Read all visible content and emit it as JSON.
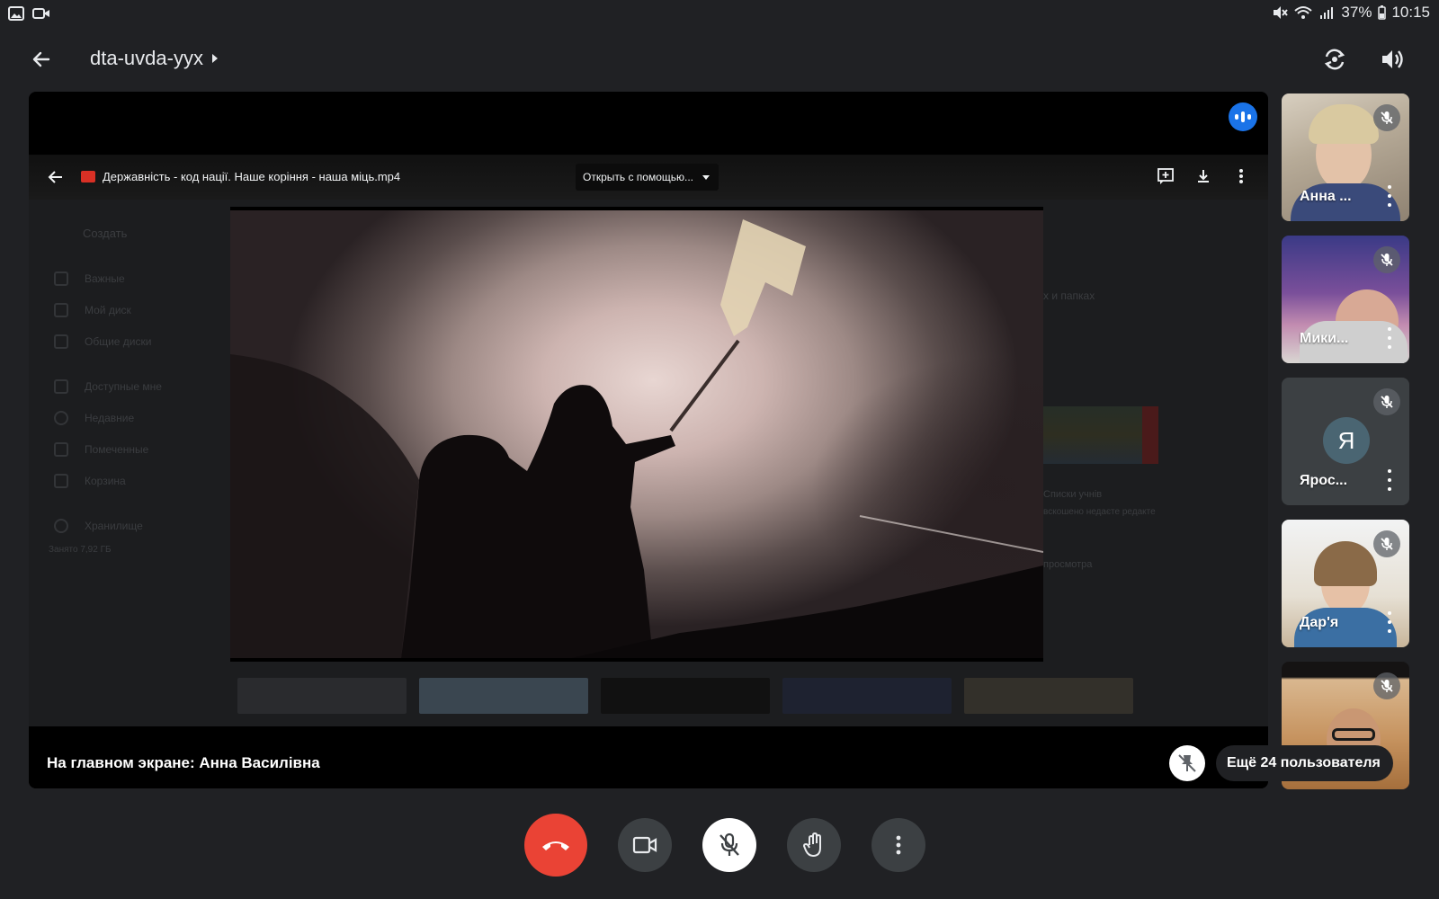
{
  "status_bar": {
    "battery": "37%",
    "time": "10:15",
    "icons": [
      "gallery-icon",
      "video-recorder-icon",
      "mute-icon",
      "wifi-icon",
      "signal-icon",
      "battery-icon"
    ]
  },
  "header": {
    "meeting_code": "dta-uvda-yyx",
    "icons": [
      "back-arrow-icon",
      "chevron-right-icon",
      "switch-camera-icon",
      "speaker-icon"
    ]
  },
  "shared_screen": {
    "file_name": "Державність - код нації. Наше коріння - наша міць.mp4",
    "open_with_label": "Открыть с помощью...",
    "background_sidebar": [
      "Создать",
      "Важные",
      "Мой диск",
      "Общие диски",
      "Доступные мне",
      "Недавние",
      "Помеченные",
      "Корзина",
      "Хранилище",
      "Занято 7,92 ГБ"
    ],
    "background_right": [
      "х и папках",
      "Списки учнів",
      "вскошено недаєте редакте",
      "просмотра"
    ]
  },
  "spotlight": {
    "label": "На главном экране: Анна Василівна"
  },
  "participants": [
    {
      "name": "Анна ...",
      "muted": true,
      "has_video": true
    },
    {
      "name": "Мики...",
      "muted": true,
      "has_video": true
    },
    {
      "name": "Ярос...",
      "muted": true,
      "has_video": false,
      "avatar_letter": "Я"
    },
    {
      "name": "Дар'я",
      "muted": true,
      "has_video": true
    },
    {
      "name": "",
      "muted": true,
      "has_video": true
    }
  ],
  "more_participants_label": "Ещё 24 пользователя",
  "controls": [
    "end-call-button",
    "camera-button",
    "microphone-button",
    "raise-hand-button",
    "more-options-button"
  ],
  "colors": {
    "background": "#202124",
    "end_call": "#ea4335",
    "speaking_indicator": "#1a73e8"
  }
}
